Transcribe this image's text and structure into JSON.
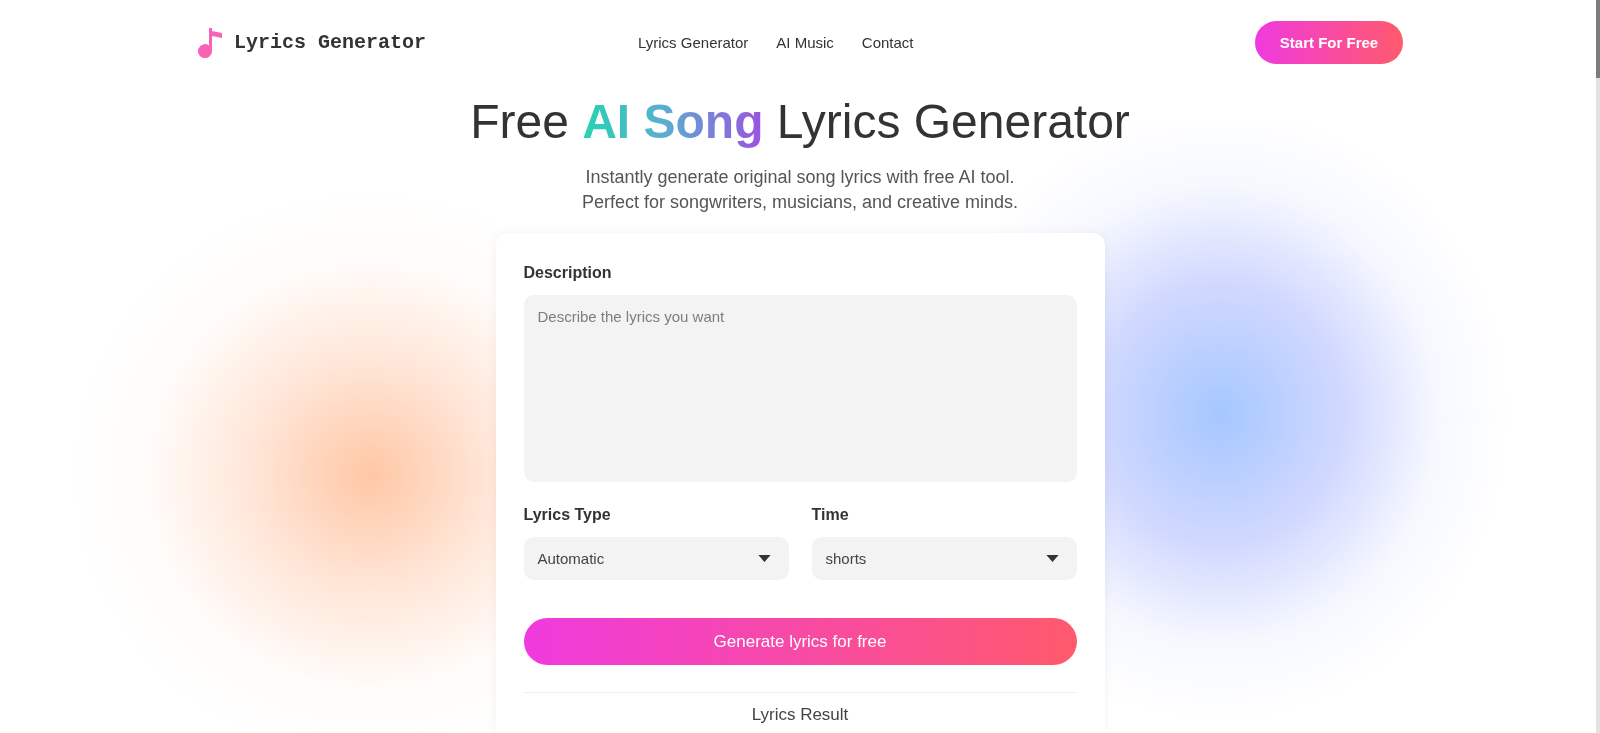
{
  "header": {
    "logo": "Lyrics Generator",
    "nav": [
      {
        "label": "Lyrics Generator"
      },
      {
        "label": "AI Music"
      },
      {
        "label": "Contact"
      }
    ],
    "cta": "Start For Free"
  },
  "hero": {
    "title": [
      {
        "text": "Free ",
        "highlight": false
      },
      {
        "text": "AI Song",
        "highlight": true
      },
      {
        "text": " Lyrics Generator",
        "highlight": false
      }
    ],
    "subtitle": [
      "Instantly generate original song lyrics with free AI tool.",
      "Perfect for songwriters, musicians, and creative minds."
    ]
  },
  "form": {
    "description": {
      "label": "Description",
      "placeholder": "Describe the lyrics you want"
    },
    "selects": [
      {
        "label": "Lyrics Type",
        "value": "Automatic"
      },
      {
        "label": "Time",
        "value": "shorts"
      }
    ],
    "submit": "Generate lyrics for free",
    "result_heading": "Lyrics Result"
  }
}
